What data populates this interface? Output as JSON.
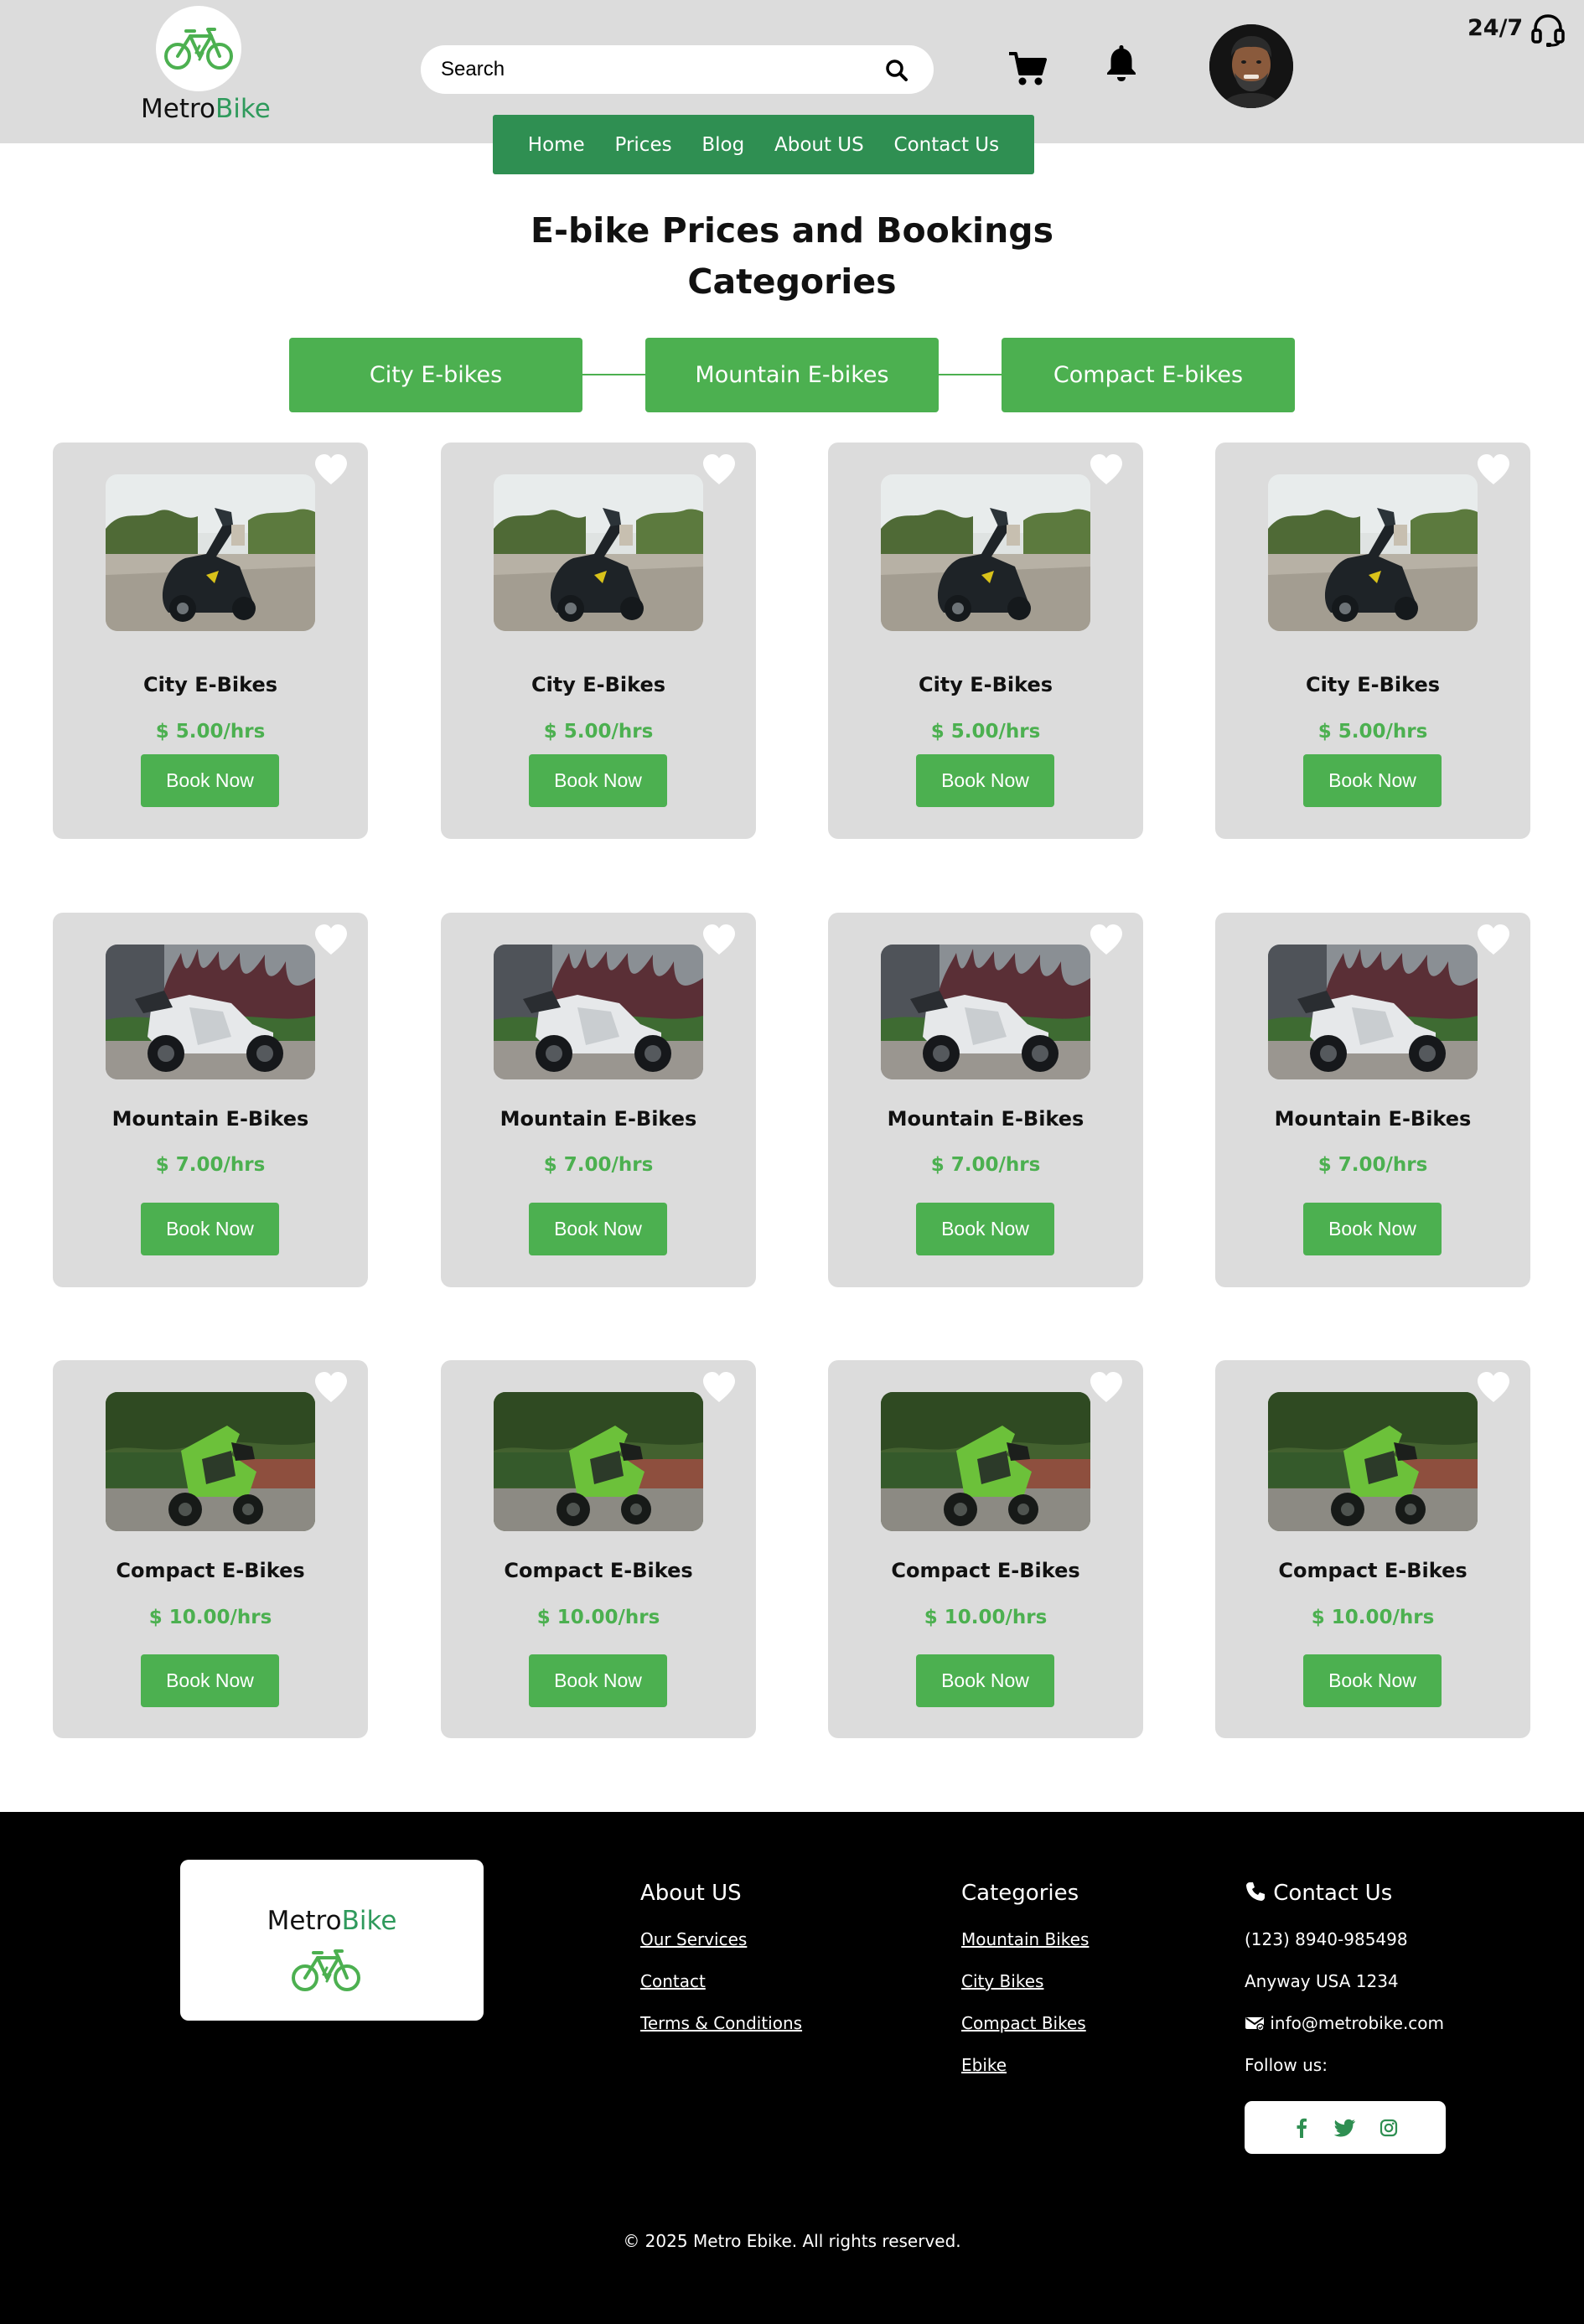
{
  "header": {
    "logo_prefix": "Metro",
    "logo_accent": "Bike",
    "search_placeholder": "Search",
    "support_label": "24/7"
  },
  "nav": {
    "items": [
      "Home",
      "Prices",
      "Blog",
      "About US",
      "Contact Us"
    ]
  },
  "page": {
    "title_line1": "E-bike Prices and Bookings",
    "title_line2": "Categories"
  },
  "tabs": [
    "City E-bikes",
    "Mountain E-bikes",
    "Compact E-bikes"
  ],
  "products": {
    "city": {
      "name": "City E-Bikes",
      "price": "$ 5.00/hrs",
      "button": "Book Now"
    },
    "mountain": {
      "name": "Mountain E-Bikes",
      "price": "$ 7.00/hrs",
      "button": "Book Now"
    },
    "compact": {
      "name": "Compact E-Bikes",
      "price": "$ 10.00/hrs",
      "button": "Book Now"
    }
  },
  "footer": {
    "logo_prefix": "Metro",
    "logo_accent": "Bike",
    "about": {
      "title": "About US",
      "links": [
        "Our Services",
        "Contact",
        "Terms & Conditions"
      ]
    },
    "categories": {
      "title": "Categories",
      "links": [
        "Mountain Bikes",
        "City Bikes",
        "Compact Bikes",
        "Ebike"
      ]
    },
    "contact": {
      "title": "Contact Us",
      "phone": "(123) 8940-985498",
      "address": "Anyway USA 1234",
      "email": "info@metrobike.com",
      "follow": "Follow us:"
    },
    "copyright": "© 2025 Metro Ebike. All rights reserved."
  },
  "colors": {
    "brand_green": "#4cb050",
    "nav_green": "#2f8f52",
    "logo_green": "#2f9a5c",
    "card_bg": "#dcdcdc",
    "footer_bg": "#000000"
  },
  "icons": [
    "bicycle-icon",
    "search-icon",
    "cart-icon",
    "bell-icon",
    "headset-icon",
    "heart-icon",
    "phone-icon",
    "email-icon",
    "facebook-icon",
    "twitter-icon",
    "instagram-icon"
  ]
}
